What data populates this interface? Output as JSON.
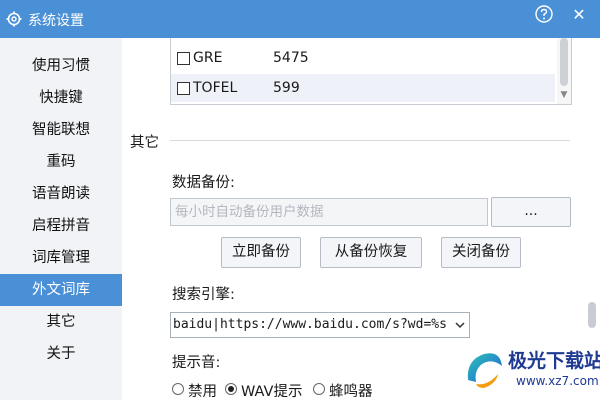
{
  "window": {
    "title": "系统设置",
    "accent_color": "#4a90d6",
    "icons": {
      "title": "gear-icon",
      "help": "help-icon",
      "close": "close-icon"
    },
    "close_glyph": "✕"
  },
  "sidebar": {
    "items": [
      {
        "label": "使用习惯"
      },
      {
        "label": "快捷键"
      },
      {
        "label": "智能联想"
      },
      {
        "label": "重码"
      },
      {
        "label": "语音朗读"
      },
      {
        "label": "启程拼音"
      },
      {
        "label": "词库管理"
      },
      {
        "label": "外文词库",
        "active": true
      },
      {
        "label": "其它"
      },
      {
        "label": "关于"
      }
    ]
  },
  "lexicon_list": {
    "rows": [
      {
        "name": "GRE",
        "count": "5475",
        "checked": false
      },
      {
        "name": "TOFEL",
        "count": "599",
        "checked": false
      }
    ]
  },
  "other_section": {
    "title": "其它",
    "backup": {
      "label": "数据备份:",
      "placeholder": "每小时自动备份用户数据",
      "browse_label": "...",
      "backup_now_label": "立即备份",
      "restore_label": "从备份恢复",
      "disable_label": "关闭备份"
    },
    "search": {
      "label": "搜索引擎:",
      "selected_value": "baidu|https://www.baidu.com/s?wd=%s"
    },
    "sound": {
      "label": "提示音:",
      "options": [
        {
          "label": "禁用",
          "checked": false
        },
        {
          "label": "WAV提示",
          "checked": true
        },
        {
          "label": "蜂鸣器",
          "checked": false
        }
      ]
    }
  },
  "watermark": {
    "name": "极光下载站",
    "url": "www.xz7.com"
  }
}
